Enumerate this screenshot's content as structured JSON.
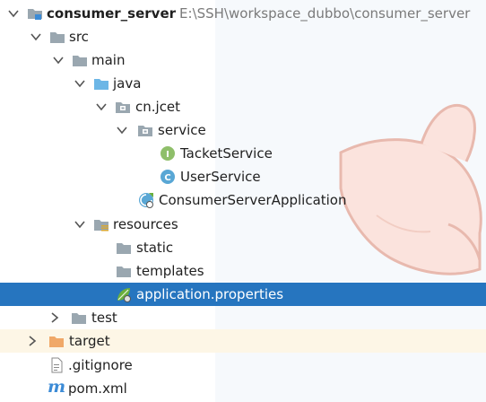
{
  "project": {
    "name": "consumer_server",
    "path": "E:\\SSH\\workspace_dubbo\\consumer_server"
  },
  "tree": {
    "src": "src",
    "main": "main",
    "java": "java",
    "package": "cn.jcet",
    "service": "service",
    "ticket_service": "TacketService",
    "user_service": "UserService",
    "app_class": "ConsumerServerApplication",
    "resources": "resources",
    "static": "static",
    "templates": "templates",
    "application_properties": "application.properties",
    "test": "test",
    "target": "target",
    "gitignore": ".gitignore",
    "pom": "pom.xml"
  },
  "badges": {
    "interface_letter": "I",
    "class_letter": "C",
    "maven_letter": "m"
  },
  "colors": {
    "selection": "#2675bf",
    "folder": "#9aa7b0",
    "source_folder": "#6cb6e6",
    "excluded_folder": "#f0a868",
    "interface_badge": "#8fbf6a",
    "class_badge": "#59a7d5",
    "spring_green": "#6aaf3d",
    "maven_blue": "#3c8bd6"
  },
  "icons": {
    "module": "module-folder-icon",
    "folder": "folder-icon",
    "source_folder": "source-folder-icon",
    "package": "package-icon",
    "resources_folder": "resources-folder-icon",
    "excluded_folder": "excluded-folder-icon",
    "interface": "interface-icon",
    "class": "class-icon",
    "spring_boot_class": "spring-boot-class-icon",
    "spring_properties": "spring-properties-icon",
    "file": "text-file-icon",
    "maven": "maven-icon"
  }
}
